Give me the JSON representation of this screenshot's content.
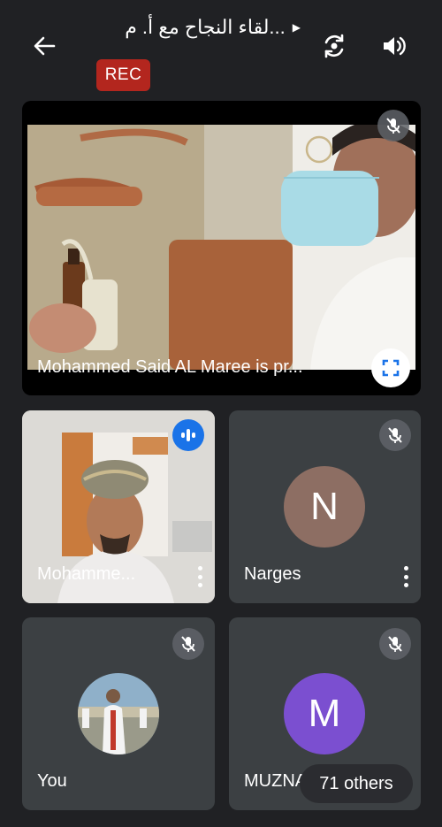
{
  "header": {
    "title": "لقاء النجاح مع أ. م...",
    "rec_label": "REC",
    "icons": [
      "back-arrow-icon",
      "switch-camera-icon",
      "volume-icon"
    ]
  },
  "presentation": {
    "label": "Mohammed Said AL Maree is pr...",
    "mic_state": "muted",
    "icons": [
      "mic-off-icon",
      "fullscreen-icon"
    ]
  },
  "tiles": [
    {
      "name": "Mohamme...",
      "state": "speaking",
      "icon": "audio-wave-icon"
    },
    {
      "name": "Narges",
      "initial": "N",
      "avatar_color": "#8d6e63",
      "state": "muted"
    },
    {
      "name": "You",
      "state": "muted"
    },
    {
      "name": "MUZNA",
      "initial": "M",
      "avatar_color": "#7b4fd0",
      "state": "muted"
    }
  ],
  "others_label": "71 others",
  "colors": {
    "background": "#202124",
    "tile": "#3c4043",
    "rec": "#b3261e",
    "speaking": "#1a73e8"
  }
}
